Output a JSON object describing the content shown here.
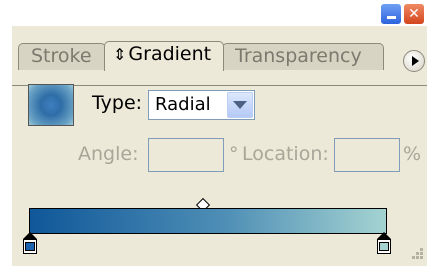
{
  "window": {
    "minimize_icon": "minimize-icon",
    "close_icon": "close-icon"
  },
  "tabs": [
    {
      "label": "Stroke",
      "active": false
    },
    {
      "label": "Gradient",
      "active": true,
      "icon": "updown-arrows-icon"
    },
    {
      "label": "Transparency",
      "active": false
    }
  ],
  "gradient": {
    "type_label": "Type:",
    "type_value": "Radial",
    "angle_label": "Angle:",
    "angle_value": "",
    "degree_symbol": "°",
    "location_label": "Location:",
    "location_value": "",
    "percent_symbol": "%",
    "colors": {
      "start": "#0f5799",
      "mid": "#4f8fb6",
      "end": "#a4d3d1",
      "left_stop": "#1d64b0",
      "right_stop": "#a4d3d1"
    }
  }
}
